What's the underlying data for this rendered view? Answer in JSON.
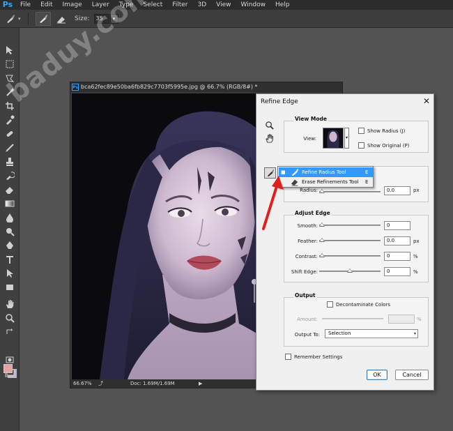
{
  "app": {
    "logo": "Ps",
    "menu": [
      "File",
      "Edit",
      "Image",
      "Layer",
      "Type",
      "Select",
      "Filter",
      "3D",
      "View",
      "Window",
      "Help"
    ]
  },
  "options_bar": {
    "size_label": "Size:",
    "size_value": "35"
  },
  "toolbar": {
    "tools": [
      "move-icon",
      "marquee-icon",
      "lasso-icon",
      "magic-wand-icon",
      "crop-icon",
      "eyedropper-icon",
      "healing-brush-icon",
      "brush-icon",
      "clone-stamp-icon",
      "history-brush-icon",
      "eraser-icon",
      "gradient-icon",
      "blur-icon",
      "dodge-icon",
      "pen-icon",
      "type-icon",
      "path-selection-icon",
      "rectangle-icon",
      "hand-icon",
      "zoom-icon",
      "swap-colors-icon"
    ],
    "foreground_color": "#e3a4a3",
    "background_color": "#c9b0d6"
  },
  "document": {
    "tab_title": "bca62fec89e50ba6fb829c7703f5995e.jpg @ 66.7% (RGB/8#) *",
    "zoom": "66.67%",
    "doc_info": "Doc: 1.69M/1.69M"
  },
  "watermark": "baduy.com",
  "dialog": {
    "title": "Refine Edge",
    "view_mode": {
      "title": "View Mode",
      "view_label": "View:",
      "show_radius": "Show Radius (J)",
      "show_original": "Show Original (P)"
    },
    "edge_detection": {
      "radius_label": "Radius:",
      "radius_value": "0.0",
      "radius_unit": "px"
    },
    "adjust_edge": {
      "title": "Adjust Edge",
      "smooth_label": "Smooth:",
      "smooth_value": "0",
      "feather_label": "Feather:",
      "feather_value": "0.0",
      "feather_unit": "px",
      "contrast_label": "Contrast:",
      "contrast_value": "0",
      "contrast_unit": "%",
      "shift_label": "Shift Edge:",
      "shift_value": "0",
      "shift_unit": "%"
    },
    "output": {
      "title": "Output",
      "decontaminate": "Decontaminate Colors",
      "amount_label": "Amount:",
      "amount_unit": "%",
      "output_to_label": "Output To:",
      "output_to_value": "Selection"
    },
    "remember": "Remember Settings",
    "ok": "OK",
    "cancel": "Cancel"
  },
  "flyout": {
    "items": [
      {
        "label": "Refine Radius Tool",
        "shortcut": "E",
        "selected": true
      },
      {
        "label": "Erase Refinements Tool",
        "shortcut": "E",
        "selected": false
      }
    ]
  }
}
